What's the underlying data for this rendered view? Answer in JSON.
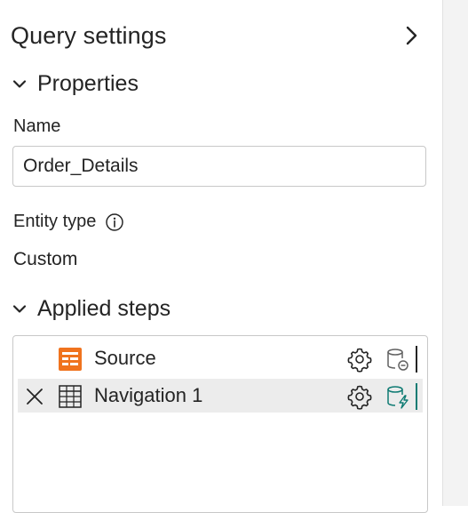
{
  "header": {
    "title": "Query settings"
  },
  "properties": {
    "section_label": "Properties",
    "name_label": "Name",
    "name_value": "Order_Details",
    "entity_type_label": "Entity type",
    "entity_type_value": "Custom"
  },
  "applied_steps": {
    "section_label": "Applied steps",
    "steps": [
      {
        "name": "Source",
        "icon": "source-table-icon",
        "selected": false,
        "status_icon": "data-source-icon",
        "status_color": "#616161"
      },
      {
        "name": "Navigation 1",
        "icon": "table-grid-icon",
        "selected": true,
        "status_icon": "data-source-fast-icon",
        "status_color": "#0f7b73"
      }
    ]
  },
  "colors": {
    "source_icon": "#f0731e",
    "accent_teal": "#0f7b73",
    "selected_row": "#ececec"
  }
}
